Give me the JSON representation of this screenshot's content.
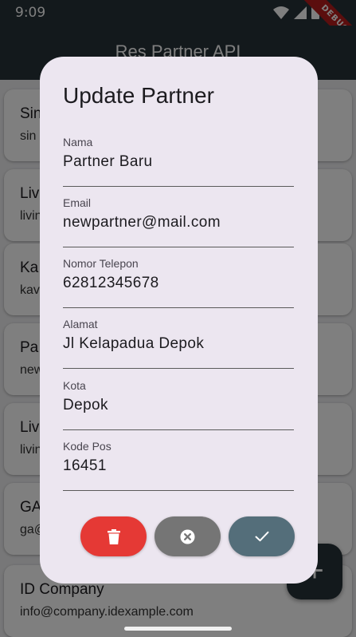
{
  "status": {
    "time": "9:09",
    "debug_label": "DEBUG"
  },
  "appbar": {
    "title": "Res Partner API"
  },
  "partners": [
    {
      "name": "Sin",
      "email": "sin"
    },
    {
      "name": "Liv",
      "email": "livin"
    },
    {
      "name": "Ka",
      "email": "kav"
    },
    {
      "name": "Pa",
      "email": "new"
    },
    {
      "name": "Liv",
      "email": "livin"
    },
    {
      "name": "GA",
      "email": "ga@"
    },
    {
      "name": "ID Company",
      "email": "info@company.idexample.com"
    }
  ],
  "fab": {
    "icon": "add-icon",
    "glyph": "+"
  },
  "dialog": {
    "title": "Update Partner",
    "fields": [
      {
        "label": "Nama",
        "value": "Partner Baru"
      },
      {
        "label": "Email",
        "value": "newpartner@mail.com"
      },
      {
        "label": "Nomor Telepon",
        "value": "62812345678"
      },
      {
        "label": "Alamat",
        "value": "Jl Kelapadua Depok"
      },
      {
        "label": "Kota",
        "value": "Depok"
      },
      {
        "label": "Kode Pos",
        "value": "16451"
      }
    ],
    "buttons": [
      {
        "icon": "trash-icon",
        "color": "#e53935"
      },
      {
        "icon": "cancel-circle-icon",
        "color": "#757575"
      },
      {
        "icon": "check-icon",
        "color": "#546e7a"
      }
    ]
  },
  "colors": {
    "appbar": "#263238",
    "dialog_bg": "#ece6f0"
  }
}
